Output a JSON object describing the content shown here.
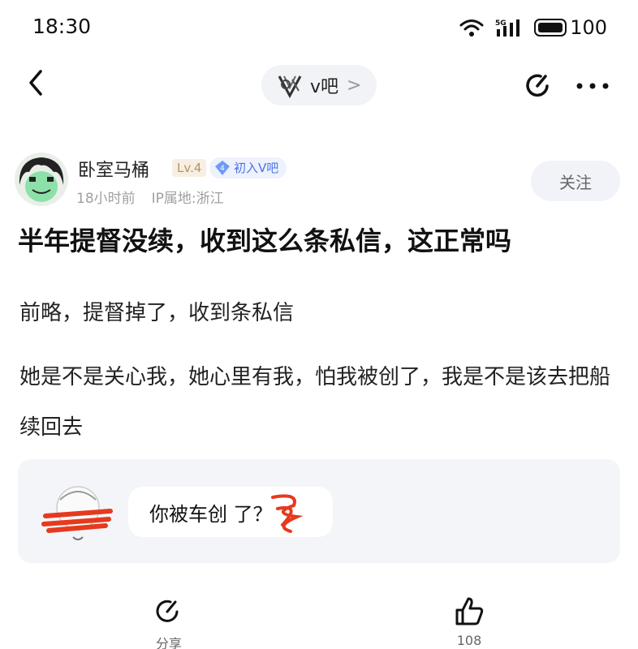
{
  "status_bar": {
    "time": "18:30",
    "network": "5G",
    "battery": "100"
  },
  "nav": {
    "forum_name": "v吧",
    "forum_chevron": ">"
  },
  "author": {
    "name": "卧室马桶",
    "level": "Lv.4",
    "member_level": "4",
    "member_badge": "初入V吧",
    "time_ago": "18小时前",
    "ip_location": "IP属地:浙江",
    "follow_label": "关注"
  },
  "post": {
    "title": "半年提督没续，收到这么条私信，这正常吗",
    "paragraph_1": "前略，提督掉了，收到条私信",
    "paragraph_2": "她是不是关心我，她心里有我，怕我被创了，我是不是该去把船续回去"
  },
  "quote": {
    "message": "你被车创 了？"
  },
  "bottom": {
    "share_label": "分享",
    "like_count": "108"
  },
  "colors": {
    "accent": "#4a73e8",
    "level_gold": "#b8935a",
    "scribble": "#e63a1e"
  },
  "icons": [
    "back-icon",
    "forum-logo-icon",
    "edit-icon",
    "more-icon",
    "diamond-icon",
    "share-icon",
    "like-icon",
    "wifi-icon",
    "signal-icon",
    "battery-icon"
  ]
}
